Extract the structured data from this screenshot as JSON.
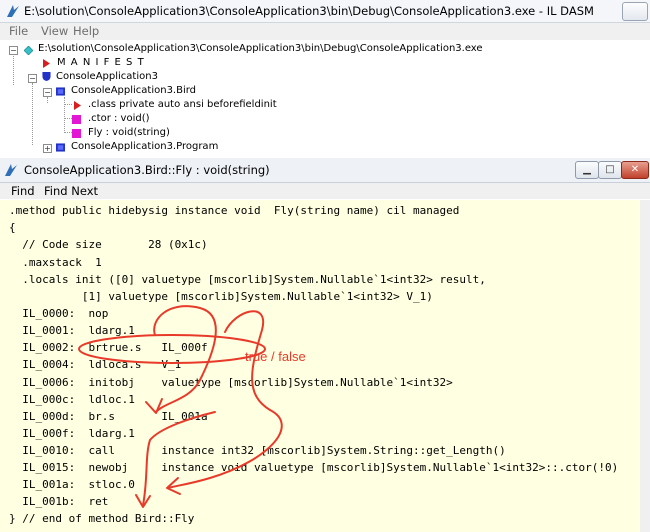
{
  "main_window": {
    "title": "E:\\solution\\ConsoleApplication3\\ConsoleApplication3\\bin\\Debug\\ConsoleApplication3.exe - IL DASM",
    "menu": [
      "File",
      "View",
      "Help"
    ],
    "tree": {
      "root": "E:\\solution\\ConsoleApplication3\\ConsoleApplication3\\bin\\Debug\\ConsoleApplication3.exe",
      "manifest": "M A N I F E S T",
      "namespace": "ConsoleApplication3",
      "class_bird": "ConsoleApplication3.Bird",
      "class_info": ".class private auto ansi beforefieldinit",
      "ctor": ".ctor : void()",
      "fly": "Fly : void(string)",
      "class_program": "ConsoleApplication3.Program"
    }
  },
  "method_window": {
    "title": "ConsoleApplication3.Bird::Fly : void(string)",
    "menu": [
      "Find",
      "Find Next"
    ],
    "code_lines": [
      ".method public hidebysig instance void  Fly(string name) cil managed",
      "{",
      "  // Code size       28 (0x1c)",
      "  .maxstack  1",
      "  .locals init ([0] valuetype [mscorlib]System.Nullable`1<int32> result,",
      "           [1] valuetype [mscorlib]System.Nullable`1<int32> V_1)",
      "  IL_0000:  nop",
      "  IL_0001:  ldarg.1",
      "  IL_0002:  brtrue.s   IL_000f",
      "  IL_0004:  ldloca.s   V_1",
      "  IL_0006:  initobj    valuetype [mscorlib]System.Nullable`1<int32>",
      "  IL_000c:  ldloc.1",
      "  IL_000d:  br.s       IL_001a",
      "  IL_000f:  ldarg.1",
      "  IL_0010:  call       instance int32 [mscorlib]System.String::get_Length()",
      "  IL_0015:  newobj     instance void valuetype [mscorlib]System.Nullable`1<int32>::.ctor(!0)",
      "  IL_001a:  stloc.0",
      "  IL_001b:  ret",
      "} // end of method Bird::Fly"
    ],
    "annotation": "true / false"
  },
  "colors": {
    "code_bg": "#ffffe1",
    "annotation": "#e83a2a"
  },
  "icons": {
    "app": "il-dasm-icon",
    "manifest": "red-triangle-icon",
    "namespace": "shield-icon",
    "class": "class-icon",
    "method": "method-icon"
  }
}
